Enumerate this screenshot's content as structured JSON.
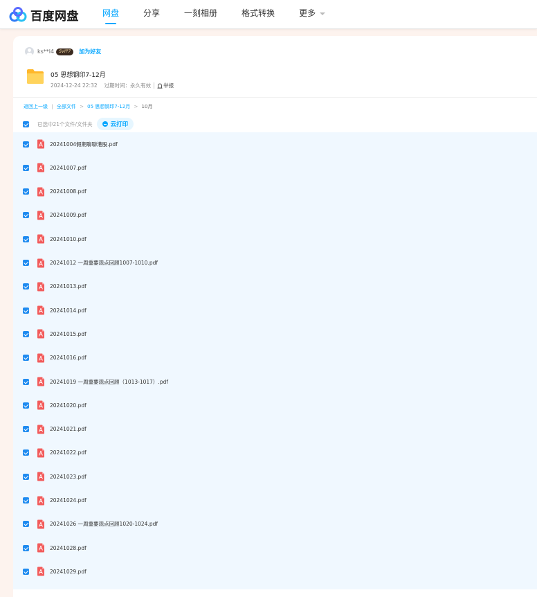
{
  "brand": {
    "name": "百度网盘"
  },
  "nav": {
    "items": [
      {
        "label": "网盘",
        "active": true
      },
      {
        "label": "分享",
        "active": false
      },
      {
        "label": "一刻相册",
        "active": false
      },
      {
        "label": "格式转换",
        "active": false
      },
      {
        "label": "更多",
        "active": false
      }
    ]
  },
  "share": {
    "username": "ks**l4",
    "badge": "SVIP7",
    "add_friend": "加为好友",
    "folder_name": "05 思想钢印7-12月",
    "date": "2024-12-24 22:32",
    "expiry": "过期时间：永久有效",
    "report": "举报"
  },
  "breadcrumb": {
    "back": "返回上一级",
    "all": "全部文件",
    "parent": "05 思想钢印7-12月",
    "current": "10月",
    "sep1": "|",
    "sep2": ">",
    "sep3": ">"
  },
  "toolbar": {
    "selected_text": "已选中21个文件/文件夹",
    "cloud_print": "云打印"
  },
  "files": [
    "20241004假期聊聊港股.pdf",
    "20241007.pdf",
    "20241008.pdf",
    "20241009.pdf",
    "20241010.pdf",
    "20241012 一周重要观点回顾1007-1010.pdf",
    "20241013.pdf",
    "20241014.pdf",
    "20241015.pdf",
    "20241016.pdf",
    "20241019 一周重要观点回顾（1013-1017）.pdf",
    "20241020.pdf",
    "20241021.pdf",
    "20241022.pdf",
    "20241023.pdf",
    "20241024.pdf",
    "20241026 一周重要观点回顾1020-1024.pdf",
    "20241028.pdf",
    "20241029.pdf"
  ],
  "colors": {
    "accent": "#06a7ff",
    "checkbox": "#1f8bf0",
    "pdf": "#f25b5b",
    "folder": "#ffc93c",
    "list_bg": "#f0f8ff"
  }
}
